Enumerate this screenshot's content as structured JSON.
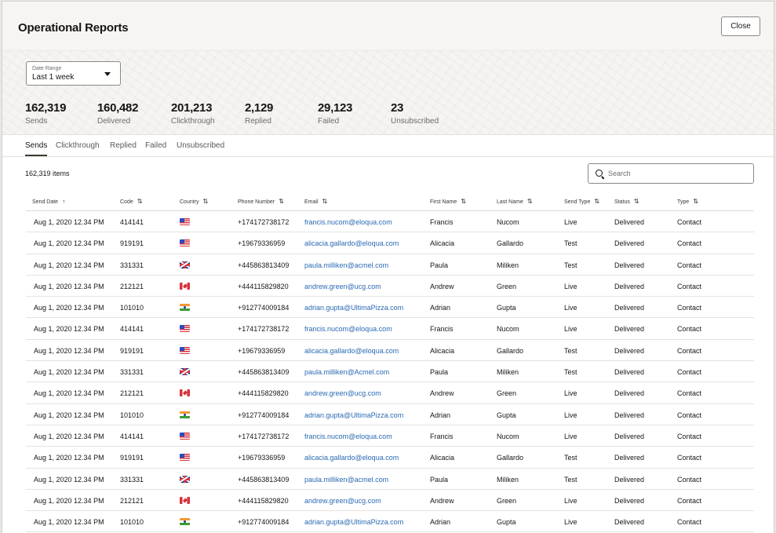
{
  "header": {
    "title": "Operational Reports",
    "close_label": "Close"
  },
  "date_range": {
    "label": "Date Range",
    "value": "Last 1 week"
  },
  "stats": [
    {
      "value": "162,319",
      "label": "Sends"
    },
    {
      "value": "160,482",
      "label": "Delivered"
    },
    {
      "value": "201,213",
      "label": "Clickthrough"
    },
    {
      "value": "2,129",
      "label": "Replied"
    },
    {
      "value": "29,123",
      "label": "Failed"
    },
    {
      "value": "23",
      "label": "Unsubscribed"
    }
  ],
  "tabs": [
    {
      "label": "Sends",
      "active": true
    },
    {
      "label": "Clickthrough",
      "active": false
    },
    {
      "label": "Replied",
      "active": false
    },
    {
      "label": "Failed",
      "active": false
    },
    {
      "label": "Unsubscribed",
      "active": false
    }
  ],
  "item_count": "162,319 items",
  "search": {
    "placeholder": "Search"
  },
  "icons": {
    "sort_asc": "↑",
    "sort_both": "⇅"
  },
  "columns": [
    {
      "label": "Send Date",
      "sort": "sort-ascending-icon"
    },
    {
      "label": "Code",
      "sort": "sort-icon"
    },
    {
      "label": "Country",
      "sort": "sort-icon"
    },
    {
      "label": "Phone Number",
      "sort": "sort-icon"
    },
    {
      "label": "Email",
      "sort": "sort-icon"
    },
    {
      "label": "First Name",
      "sort": "sort-icon"
    },
    {
      "label": "Last Name",
      "sort": "sort-icon"
    },
    {
      "label": "Send Type",
      "sort": "sort-icon"
    },
    {
      "label": "Status",
      "sort": "sort-icon"
    },
    {
      "label": "Type",
      "sort": "sort-icon"
    }
  ],
  "rows": [
    {
      "send_date": "Aug 1, 2020  12.34 PM",
      "code": "414141",
      "country": "us",
      "phone": "+174172738172",
      "email": "francis.nucom@eloqua.com",
      "first": "Francis",
      "last": "Nucom",
      "send_type": "Live",
      "status": "Delivered",
      "type": "Contact"
    },
    {
      "send_date": "Aug 1, 2020  12.34 PM",
      "code": "919191",
      "country": "us",
      "phone": "+19679336959",
      "email": "alicacia.gallardo@eloqua.com",
      "first": "Alicacia",
      "last": "Gallardo",
      "send_type": "Test",
      "status": "Delivered",
      "type": "Contact"
    },
    {
      "send_date": "Aug 1, 2020  12.34 PM",
      "code": "331331",
      "country": "gb",
      "phone": "+445863813409",
      "email": "paula.milliken@acmel.com",
      "first": "Paula",
      "last": "Miliken",
      "send_type": "Test",
      "status": "Delivered",
      "type": "Contact"
    },
    {
      "send_date": "Aug 1, 2020  12.34 PM",
      "code": "212121",
      "country": "ca",
      "phone": "+444115829820",
      "email": "andrew.green@ucg.com",
      "first": "Andrew",
      "last": "Green",
      "send_type": "Live",
      "status": "Delivered",
      "type": "Contact"
    },
    {
      "send_date": "Aug 1, 2020  12.34 PM",
      "code": "101010",
      "country": "in",
      "phone": "+912774009184",
      "email": "adrian.gupta@UltimaPizza.com",
      "first": "Adrian",
      "last": "Gupta",
      "send_type": "Live",
      "status": "Delivered",
      "type": "Contact"
    },
    {
      "send_date": "Aug 1, 2020  12.34 PM",
      "code": "414141",
      "country": "us",
      "phone": "+174172738172",
      "email": "francis.nucom@eloqua.com",
      "first": "Francis",
      "last": "Nucom",
      "send_type": "Live",
      "status": "Delivered",
      "type": "Contact"
    },
    {
      "send_date": "Aug 1, 2020  12.34 PM",
      "code": "919191",
      "country": "us",
      "phone": "+19679336959",
      "email": "alicacia.gallardo@eloqua.com",
      "first": "Alicacia",
      "last": "Gallardo",
      "send_type": "Test",
      "status": "Delivered",
      "type": "Contact"
    },
    {
      "send_date": "Aug 1, 2020  12.34 PM",
      "code": "331331",
      "country": "gb",
      "phone": "+445863813409",
      "email": "paula.milliken@Acmel.com",
      "first": "Paula",
      "last": "Miliken",
      "send_type": "Test",
      "status": "Delivered",
      "type": "Contact"
    },
    {
      "send_date": "Aug 1, 2020  12.34 PM",
      "code": "212121",
      "country": "ca",
      "phone": "+444115829820",
      "email": "andrew.green@ucg.com",
      "first": "Andrew",
      "last": "Green",
      "send_type": "Live",
      "status": "Delivered",
      "type": "Contact"
    },
    {
      "send_date": "Aug 1, 2020  12.34 PM",
      "code": "101010",
      "country": "in",
      "phone": "+912774009184",
      "email": "adrian.gupta@UltimaPizza.com",
      "first": "Adrian",
      "last": "Gupta",
      "send_type": "Live",
      "status": "Delivered",
      "type": "Contact"
    },
    {
      "send_date": "Aug 1, 2020  12.34 PM",
      "code": "414141",
      "country": "us",
      "phone": "+174172738172",
      "email": "francis.nucom@eloqua.com",
      "first": "Francis",
      "last": "Nucom",
      "send_type": "Live",
      "status": "Delivered",
      "type": "Contact"
    },
    {
      "send_date": "Aug 1, 2020  12.34 PM",
      "code": "919191",
      "country": "us",
      "phone": "+19679336959",
      "email": "alicacia.gallardo@eloqua.com",
      "first": "Alicacia",
      "last": "Gallardo",
      "send_type": "Test",
      "status": "Delivered",
      "type": "Contact"
    },
    {
      "send_date": "Aug 1, 2020  12.34 PM",
      "code": "331331",
      "country": "gb",
      "phone": "+445863813409",
      "email": "paula.milliken@acmel.com",
      "first": "Paula",
      "last": "Miliken",
      "send_type": "Test",
      "status": "Delivered",
      "type": "Contact"
    },
    {
      "send_date": "Aug 1, 2020  12.34 PM",
      "code": "212121",
      "country": "ca",
      "phone": "+444115829820",
      "email": "andrew.green@ucg.com",
      "first": "Andrew",
      "last": "Green",
      "send_type": "Live",
      "status": "Delivered",
      "type": "Contact"
    },
    {
      "send_date": "Aug 1, 2020  12.34 PM",
      "code": "101010",
      "country": "in",
      "phone": "+912774009184",
      "email": "adrian.gupta@UltimaPizza.com",
      "first": "Adrian",
      "last": "Gupta",
      "send_type": "Live",
      "status": "Delivered",
      "type": "Contact"
    }
  ],
  "colors": {
    "link": "#2a6ab3",
    "text": "#161513",
    "muted": "#6f6c69",
    "border": "#8b8884"
  }
}
